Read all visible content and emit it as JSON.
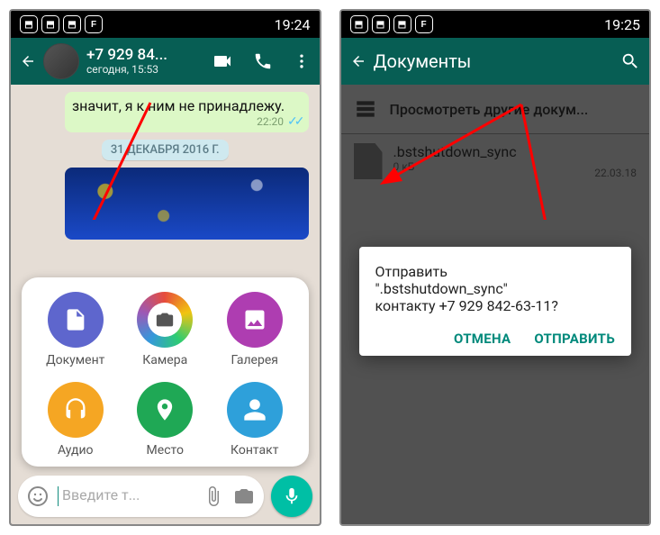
{
  "phone1": {
    "status_time": "19:24",
    "contact_title": "+7 929 84...",
    "contact_subtitle": "сегодня, 15:53",
    "msg_text": "значит, я к ним не принадлежу.",
    "msg_time": "22:20",
    "date_chip": "31 ДЕКАБРЯ 2016 Г.",
    "attach": {
      "document": "Документ",
      "camera": "Камера",
      "gallery": "Галерея",
      "audio": "Аудио",
      "location": "Место",
      "contact": "Контакт"
    },
    "input_placeholder": "Введите т..."
  },
  "phone2": {
    "status_time": "19:25",
    "screen_title": "Документы",
    "browse_label": "Просмотреть другие докум...",
    "file_name": ".bstshutdown_sync",
    "file_size": "0 кБ",
    "file_date": "22.03.18",
    "dialog_line1": "Отправить",
    "dialog_line2": "\".bstshutdown_sync\"",
    "dialog_line3": "контакту +7 929 842-63-11?",
    "btn_cancel": "ОТМЕНА",
    "btn_send": "ОТПРАВИТЬ"
  }
}
